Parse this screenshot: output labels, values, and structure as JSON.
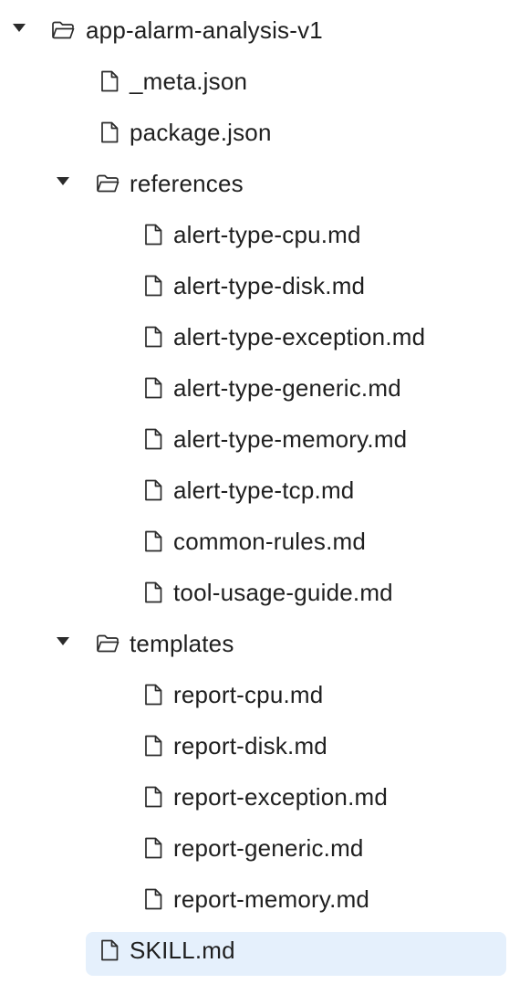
{
  "tree": [
    {
      "type": "folder",
      "level": 0,
      "expanded": true,
      "label": "app-alarm-analysis-v1"
    },
    {
      "type": "file",
      "level": 1,
      "label": "_meta.json"
    },
    {
      "type": "file",
      "level": 1,
      "label": "package.json"
    },
    {
      "type": "folder",
      "level": 1,
      "expanded": true,
      "label": "references"
    },
    {
      "type": "file",
      "level": 2,
      "label": "alert-type-cpu.md"
    },
    {
      "type": "file",
      "level": 2,
      "label": "alert-type-disk.md"
    },
    {
      "type": "file",
      "level": 2,
      "label": "alert-type-exception.md"
    },
    {
      "type": "file",
      "level": 2,
      "label": "alert-type-generic.md"
    },
    {
      "type": "file",
      "level": 2,
      "label": "alert-type-memory.md"
    },
    {
      "type": "file",
      "level": 2,
      "label": "alert-type-tcp.md"
    },
    {
      "type": "file",
      "level": 2,
      "label": "common-rules.md"
    },
    {
      "type": "file",
      "level": 2,
      "label": "tool-usage-guide.md"
    },
    {
      "type": "folder",
      "level": 1,
      "expanded": true,
      "label": "templates"
    },
    {
      "type": "file",
      "level": 2,
      "label": "report-cpu.md"
    },
    {
      "type": "file",
      "level": 2,
      "label": "report-disk.md"
    },
    {
      "type": "file",
      "level": 2,
      "label": "report-exception.md"
    },
    {
      "type": "file",
      "level": 2,
      "label": "report-generic.md"
    },
    {
      "type": "file",
      "level": 2,
      "label": "report-memory.md"
    },
    {
      "type": "file",
      "level": 1,
      "selected": true,
      "label": "SKILL.md"
    }
  ],
  "colors": {
    "selection_bg": "#e5f0fc",
    "text": "#1f1f1f",
    "icon_stroke": "#2b2b2b"
  },
  "icons": {
    "folder": "folder-open-icon",
    "file": "file-icon",
    "toggle": "chevron-down-icon"
  }
}
